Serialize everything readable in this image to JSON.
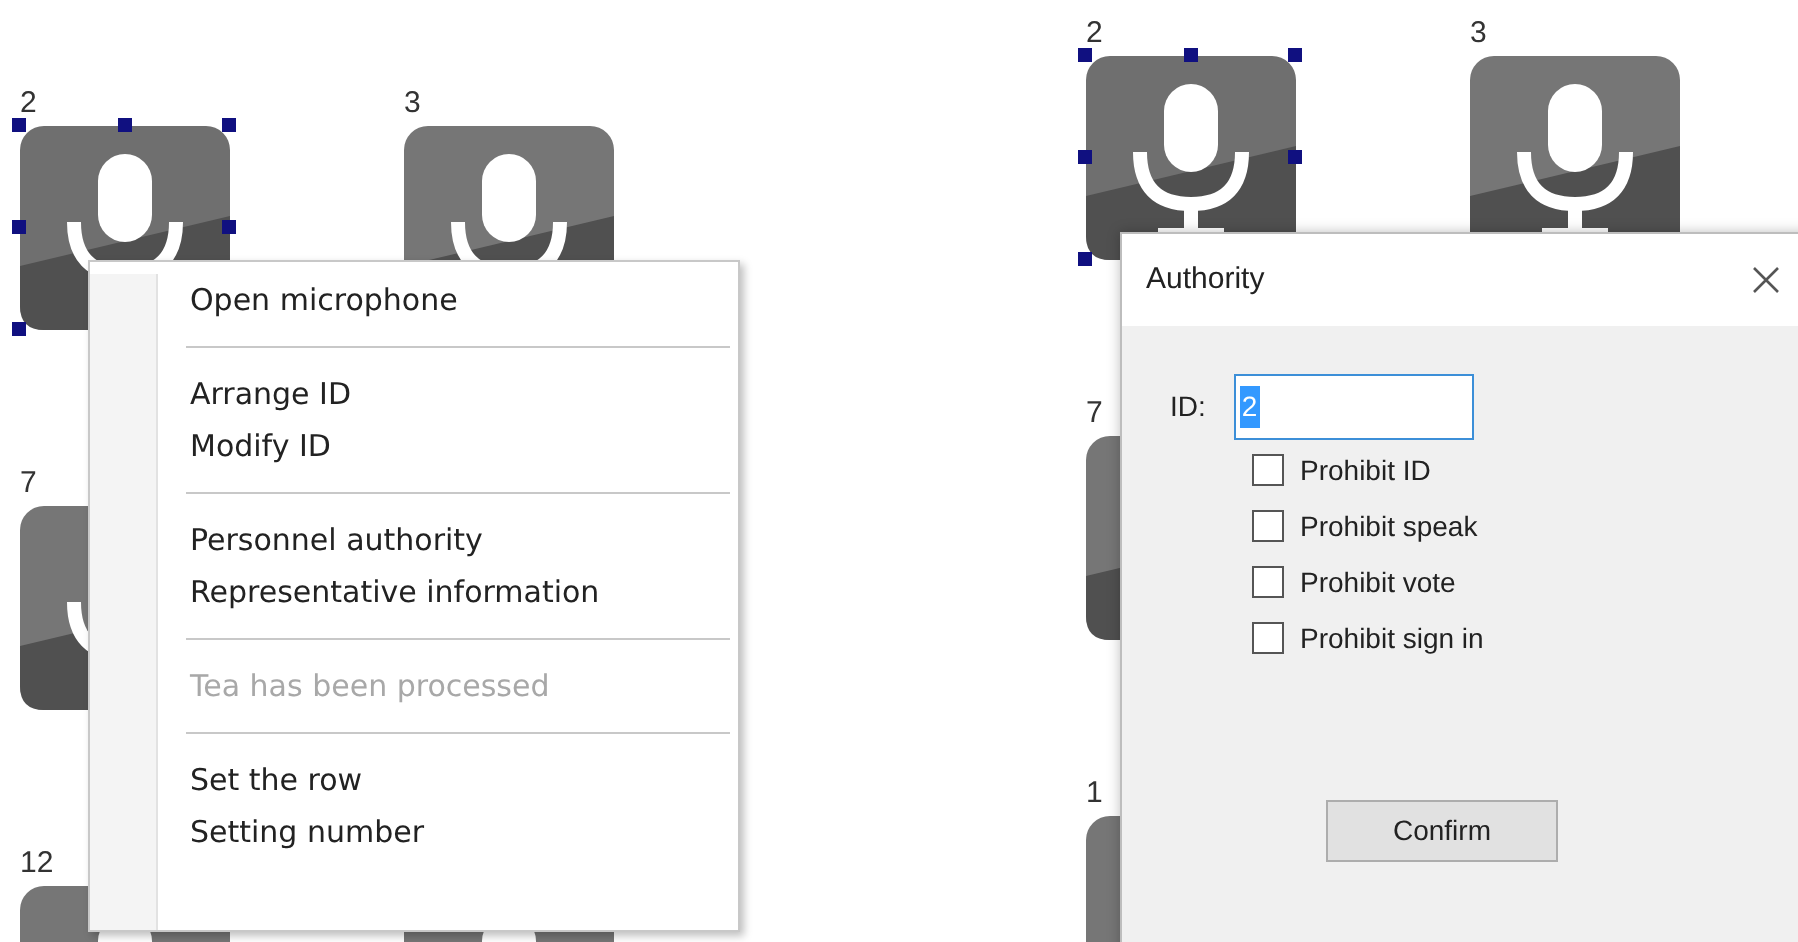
{
  "left_panel": {
    "tiles": [
      {
        "kind": "mic",
        "label": "2",
        "selected": true
      },
      {
        "kind": "mic",
        "label": "3",
        "selected": false
      },
      {
        "kind": "mic",
        "label": "7",
        "selected": false
      },
      {
        "kind": "covered"
      },
      {
        "kind": "mic",
        "label": "12",
        "selected": false
      },
      {
        "kind": "covered"
      }
    ],
    "context_menu": {
      "items": [
        {
          "kind": "item",
          "label": "Open microphone",
          "disabled": false
        },
        {
          "kind": "separator"
        },
        {
          "kind": "item",
          "label": "Arrange ID",
          "disabled": false
        },
        {
          "kind": "item",
          "label": "Modify ID",
          "disabled": false
        },
        {
          "kind": "separator"
        },
        {
          "kind": "item",
          "label": "Personnel authority",
          "disabled": false
        },
        {
          "kind": "item",
          "label": "Representative information",
          "disabled": false
        },
        {
          "kind": "separator"
        },
        {
          "kind": "item",
          "label": "Tea has been processed",
          "disabled": true
        },
        {
          "kind": "separator"
        },
        {
          "kind": "item",
          "label": "Set the row",
          "disabled": false
        },
        {
          "kind": "item",
          "label": "Setting number",
          "disabled": false
        }
      ]
    }
  },
  "right_panel": {
    "tiles": [
      {
        "kind": "mic",
        "label": "2",
        "selected": true
      },
      {
        "kind": "mic",
        "label": "3",
        "selected": false
      },
      {
        "kind": "mic",
        "label": "7",
        "selected": false
      },
      {
        "kind": "covered"
      },
      {
        "kind": "mic",
        "label": "1",
        "selected": false
      },
      {
        "kind": "covered"
      }
    ],
    "dialog": {
      "title": "Authority",
      "id_label": "ID:",
      "id_value": "2",
      "options": [
        {
          "label": "Prohibit ID",
          "checked": false
        },
        {
          "label": "Prohibit speak",
          "checked": false
        },
        {
          "label": "Prohibit vote",
          "checked": false
        },
        {
          "label": "Prohibit sign in",
          "checked": false
        }
      ],
      "confirm": "Confirm"
    }
  }
}
